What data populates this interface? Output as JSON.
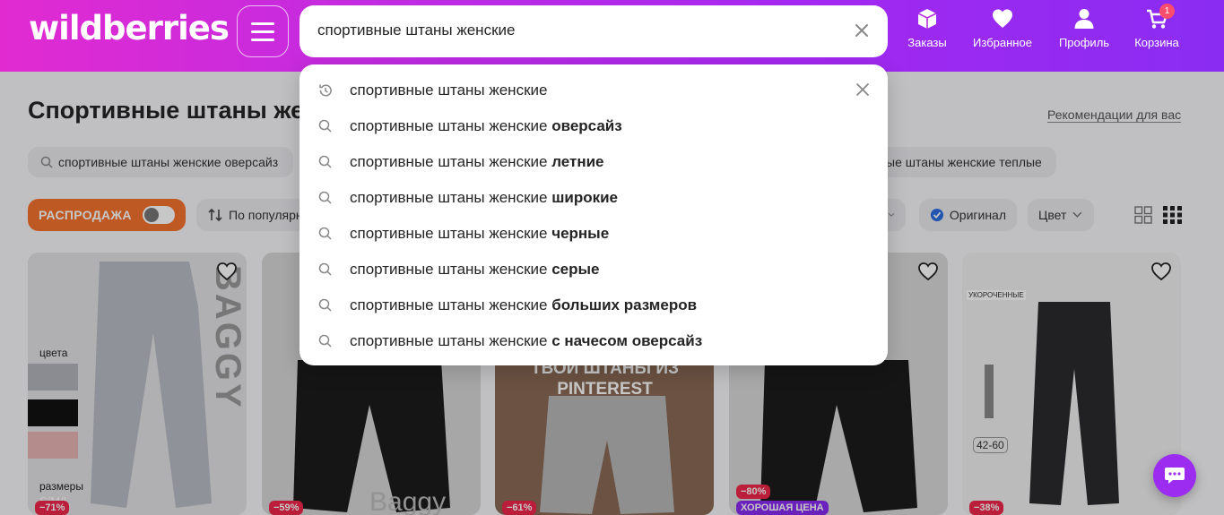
{
  "header": {
    "logo": "wildberries",
    "search_value": "спортивные штаны женские",
    "nav": [
      {
        "label": "Заказы",
        "icon": "box-icon"
      },
      {
        "label": "Избранное",
        "icon": "heart-icon"
      },
      {
        "label": "Профиль",
        "icon": "user-icon"
      },
      {
        "label": "Корзина",
        "icon": "cart-icon",
        "badge": "1"
      }
    ]
  },
  "page": {
    "title": "Спортивные штаны же",
    "recommendations_link": "Рекомендации для вас",
    "chips": [
      "спортивные штаны женские оверсайз",
      "ые штаны женские теплые"
    ],
    "sale_label": "РАСПРОДАЖА",
    "sort_label": "По популярн",
    "original_label": "Оригинал",
    "color_label": "Цвет"
  },
  "cards": [
    {
      "overlay_text": "BAGGY",
      "colors_label": "цвета",
      "sizes_label": "размеры",
      "sizes": "S/M/L",
      "discount": "−71%"
    },
    {
      "overlay_text": "Baggy",
      "discount": "−59%"
    },
    {
      "overlay_text": "ТВОИ ШТАНЫ ИЗ PINTEREST",
      "discount": "−61%"
    },
    {
      "discount": "−80%",
      "badge": "ХОРОШАЯ ЦЕНА"
    },
    {
      "tag": "УКОРОЧЕННЫЕ",
      "size_range": "42-60",
      "discount": "−38%"
    }
  ],
  "suggestions": {
    "base": "спортивные штаны женские",
    "items": [
      {
        "type": "history",
        "suffix": ""
      },
      {
        "type": "search",
        "suffix": "оверсайз"
      },
      {
        "type": "search",
        "suffix": "летние"
      },
      {
        "type": "search",
        "suffix": "широкие"
      },
      {
        "type": "search",
        "suffix": "черные"
      },
      {
        "type": "search",
        "suffix": "серые"
      },
      {
        "type": "search",
        "suffix": "больших размеров"
      },
      {
        "type": "search",
        "suffix": "с начесом оверсайз"
      }
    ]
  },
  "colors": {
    "sale": "#f5732d",
    "brand": "#a428f0",
    "discount": "#f0274b"
  }
}
